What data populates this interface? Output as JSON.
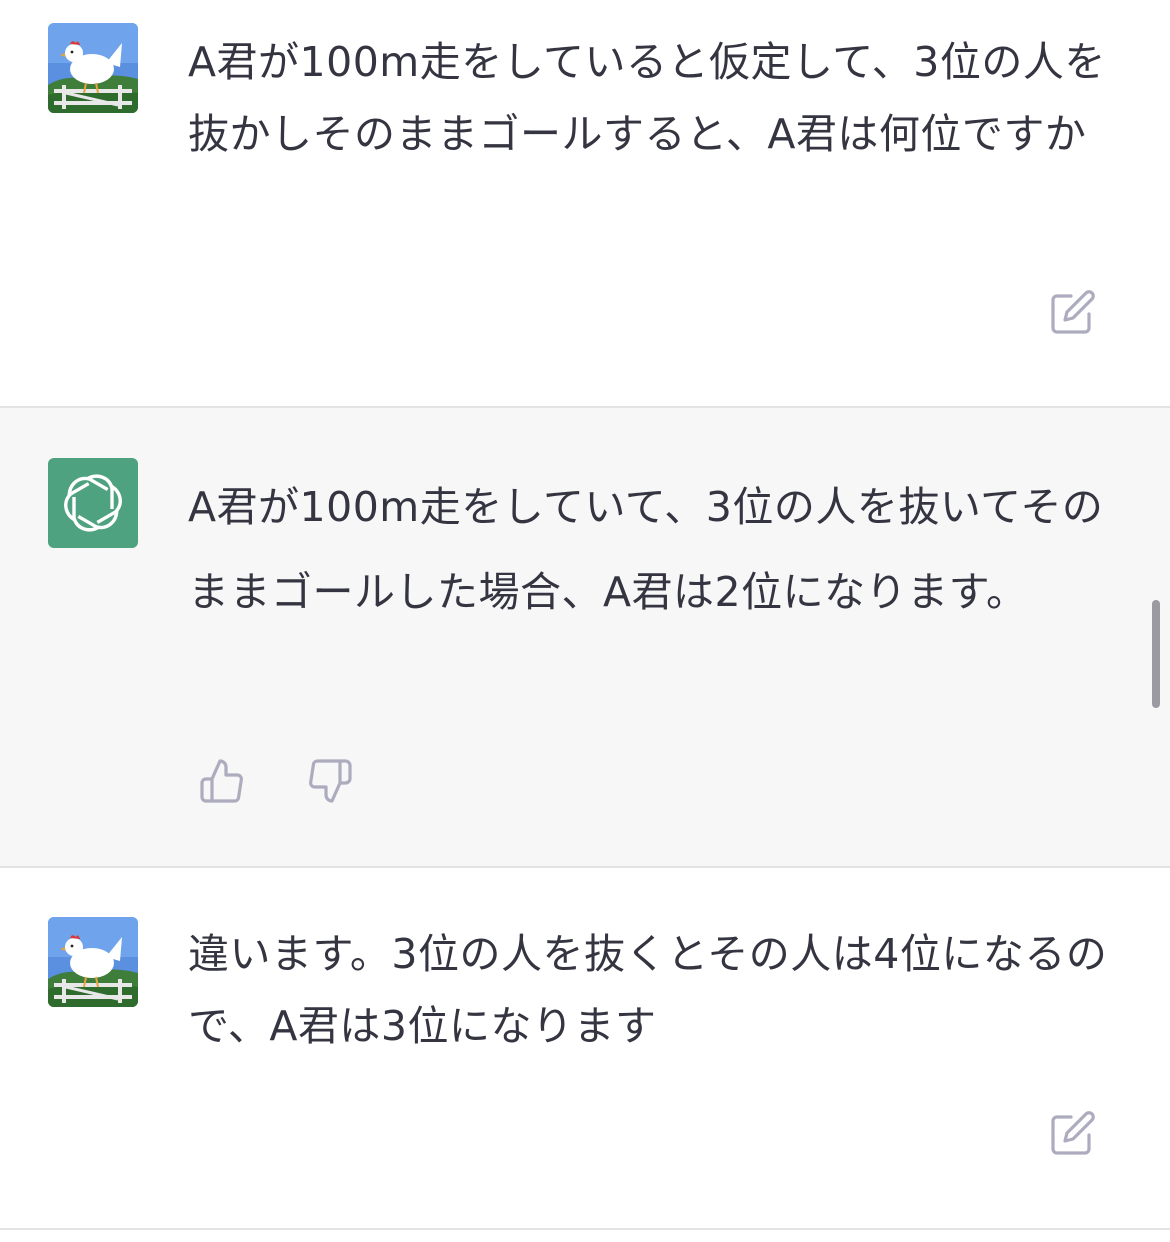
{
  "conversation": [
    {
      "role": "user",
      "text": "A君が100m走をしていると仮定して、3位の人を抜かしそのままゴールすると、A君は何位ですか"
    },
    {
      "role": "assistant",
      "text": "A君が100m走をしていて、3位の人を抜いてそのままゴールした場合、A君は2位になります。"
    },
    {
      "role": "user",
      "text": "違います。3位の人を抜くとその人は4位になるので、A君は3位になります"
    }
  ],
  "icons": {
    "user_avatar": "chicken-avatar-icon",
    "assistant_avatar": "openai-logo-icon",
    "edit": "edit-icon",
    "thumbs_up": "thumbs-up-icon",
    "thumbs_down": "thumbs-down-icon"
  },
  "colors": {
    "assistant_bg": "#f7f7f8",
    "assistant_avatar_bg": "#4fa27f",
    "text": "#343541",
    "icon": "#acacbe"
  }
}
